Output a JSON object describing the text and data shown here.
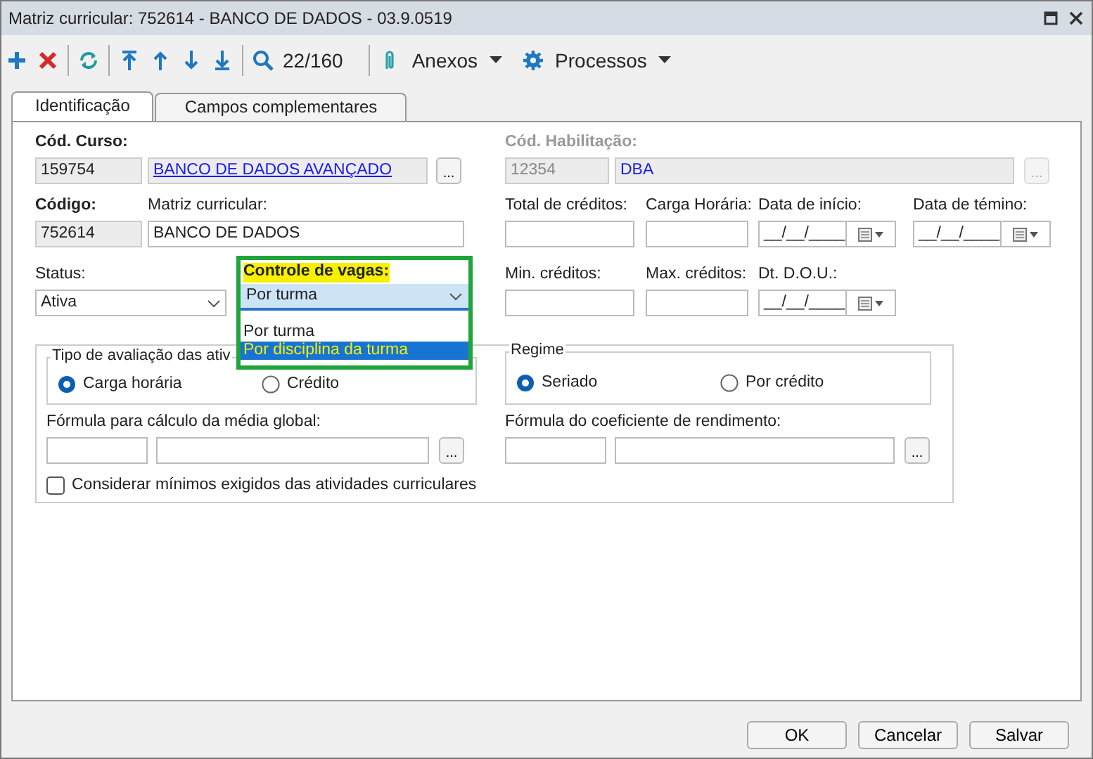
{
  "window": {
    "title": "Matriz curricular: 752614 - BANCO DE DADOS - 03.9.0519"
  },
  "toolbar": {
    "record_counter": "22/160",
    "menus": [
      {
        "label": "Anexos"
      },
      {
        "label": "Processos"
      }
    ]
  },
  "tabs": [
    {
      "label": "Identificação",
      "selected": true
    },
    {
      "label": "Campos complementares",
      "selected": false
    }
  ],
  "curso": {
    "label": "Cód. Curso:",
    "required": true,
    "disabled": false,
    "code": "159754",
    "name": "BANCO DE DADOS AVANÇADO",
    "button": "..."
  },
  "habilitacao": {
    "label": "Cód. Habilitação:",
    "required": true,
    "disabled": true,
    "code": "12354",
    "name": "DBA",
    "button": "..."
  },
  "codigo": {
    "label": "Código:",
    "required": true,
    "value": "752614"
  },
  "matriz": {
    "label": "Matriz curricular:",
    "required": false,
    "value": "BANCO DE DADOS"
  },
  "total_creditos": {
    "label": "Total de créditos:"
  },
  "carga_horaria": {
    "label": "Carga Horária:"
  },
  "data_inicio": {
    "label": "Data de início:",
    "value": "__/__/____"
  },
  "data_termino": {
    "label": "Data de témino:",
    "value": "__/__/____"
  },
  "status": {
    "label": "Status:",
    "value": "Ativa"
  },
  "controle_vagas": {
    "label": "Controle de vagas:",
    "required": true,
    "highlighted": true,
    "value": "Por turma",
    "expanded": true,
    "options": [
      {
        "label": "Por turma",
        "highlighted": false
      },
      {
        "label": "Por disciplina da turma",
        "highlighted": true
      }
    ]
  },
  "min_creditos": {
    "label": "Min. créditos:"
  },
  "max_creditos": {
    "label": "Max. créditos:"
  },
  "dt_dou": {
    "label": "Dt. D.O.U.:",
    "value": "__/__/____"
  },
  "tipo_avaliacao": {
    "title": "Tipo de avaliação das ativ",
    "options": [
      {
        "label": "Carga horária",
        "selected": true
      },
      {
        "label": "Crédito",
        "selected": false
      }
    ]
  },
  "regime": {
    "title": "Regime",
    "options": [
      {
        "label": "Seriado",
        "selected": true
      },
      {
        "label": "Por crédito",
        "selected": false
      }
    ]
  },
  "formula_media": {
    "label": "Fórmula para cálculo da média global:",
    "button": "..."
  },
  "formula_coeficiente": {
    "label": "Fórmula do coeficiente de rendimento:",
    "button": "..."
  },
  "considerar_minimos": {
    "label": "Considerar mínimos exigidos das atividades curriculares",
    "checked": false
  },
  "buttons": [
    {
      "label": "OK"
    },
    {
      "label": "Cancelar"
    },
    {
      "label": "Salvar"
    }
  ]
}
